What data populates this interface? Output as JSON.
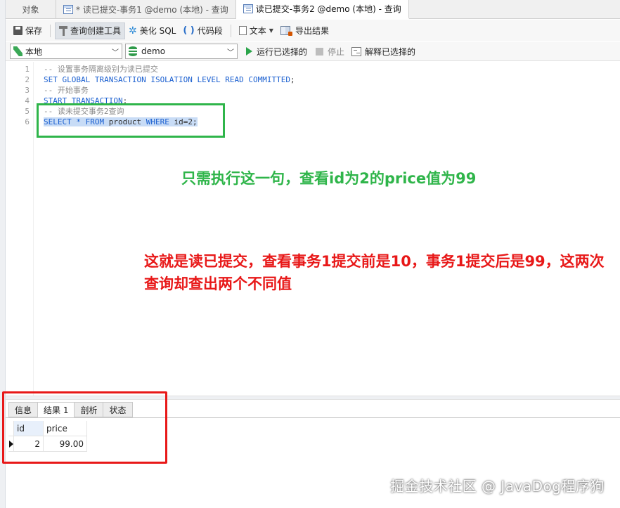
{
  "tabs": [
    {
      "label": "对象"
    },
    {
      "label": "* 读已提交-事务1 @demo (本地) - 查询"
    },
    {
      "label": "读已提交-事务2 @demo (本地) - 查询"
    }
  ],
  "toolbar": {
    "save": "保存",
    "query_builder": "查询创建工具",
    "beautify": "美化 SQL",
    "snippet": "代码段",
    "text": "文本",
    "export": "导出结果"
  },
  "selectors": {
    "connection": "本地",
    "database": "demo",
    "run_selected": "运行已选择的",
    "stop": "停止",
    "explain_selected": "解释已选择的"
  },
  "editor": {
    "lines": [
      {
        "n": "1",
        "text": "-- 设置事务隔离级别为读已提交"
      },
      {
        "n": "2",
        "kw1": "SET GLOBAL TRANSACTION ISOLATION LEVEL READ COMMITTED",
        "tail": ";"
      },
      {
        "n": "3",
        "text": "-- 开始事务"
      },
      {
        "n": "4",
        "kw1": "START TRANSACTION",
        "tail": ";"
      },
      {
        "n": "5",
        "text": "-- 读未提交事务2查询"
      },
      {
        "n": "6",
        "kw1": "SELECT * FROM",
        "mid": " product ",
        "kw2": "WHERE",
        "tail": " id=2;"
      }
    ]
  },
  "annotations": {
    "green_note": "只需执行这一句，查看id为2的price值为99",
    "red_note": "这就是读已提交，查看事务1提交前是10，事务1提交后是99，这两次查询却查出两个不同值",
    "colors": {
      "green": "#2fb54a",
      "red": "#e81818"
    }
  },
  "results": {
    "tabs": [
      "信息",
      "结果 1",
      "剖析",
      "状态"
    ],
    "active_tab": "结果 1",
    "columns": [
      "id",
      "price"
    ],
    "rows": [
      [
        "2",
        "99.00"
      ]
    ]
  },
  "watermark": "掘金技术社区 @ JavaDog程序狗"
}
